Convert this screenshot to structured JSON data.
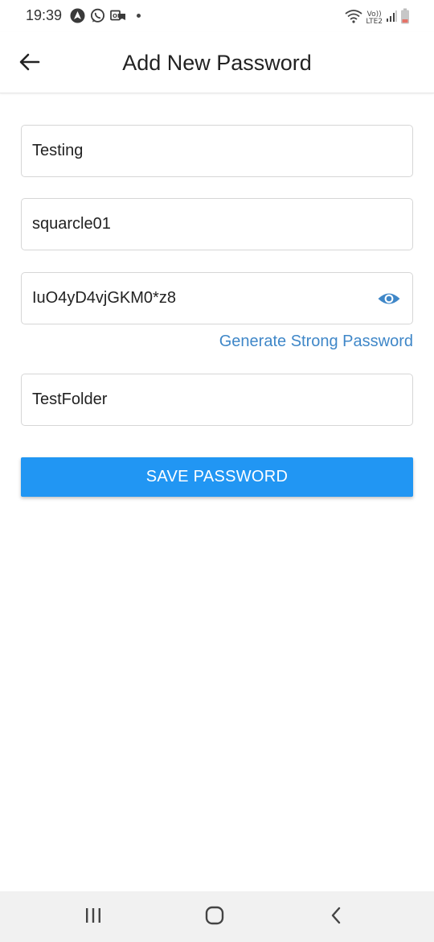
{
  "status_bar": {
    "time": "19:39",
    "left_icons": [
      "navigation-app-icon",
      "whatsapp-icon",
      "message-icon"
    ],
    "right_icons": [
      "wifi-icon",
      "volte-icon",
      "signal-icon",
      "battery-icon"
    ],
    "volte_top": "Vo))",
    "volte_bottom": "LTE2"
  },
  "header": {
    "title": "Add New Password",
    "back_icon": "arrow-left-icon"
  },
  "form": {
    "title_value": "Testing",
    "username_value": "squarcle01",
    "password_value": "IuO4yD4vjGKM0*z8",
    "password_toggle_icon": "eye-icon",
    "generate_link": "Generate Strong Password",
    "folder_value": "TestFolder",
    "save_label": "SAVE PASSWORD"
  },
  "nav_bar": {
    "recents_icon": "recents-icon",
    "home_icon": "home-icon",
    "back_icon": "chevron-left-icon"
  },
  "colors": {
    "accent": "#2196f3",
    "link": "#3f87c8",
    "battery_low": "#e57368"
  }
}
